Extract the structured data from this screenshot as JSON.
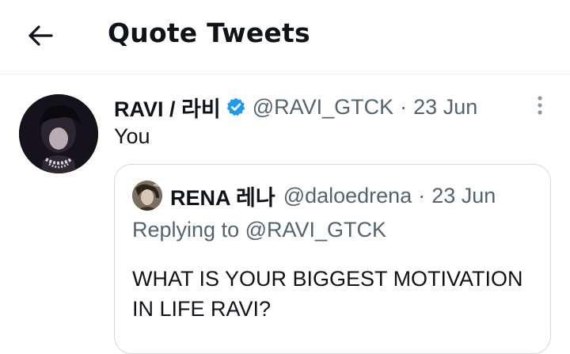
{
  "header": {
    "title": "Quote Tweets",
    "back_icon": "arrow-left-icon"
  },
  "tweet": {
    "display_name": "RAVI / 라비",
    "verified": true,
    "handle": "@RAVI_GTCK",
    "separator": "·",
    "date": "23 Jun",
    "text": "You",
    "more_icon": "more-vertical-icon",
    "quoted": {
      "display_name": "RENA 레나",
      "handle": "@daloedrena",
      "separator": "·",
      "date": "23 Jun",
      "replying_label": "Replying to",
      "replying_handle": "@RAVI_GTCK",
      "text": "WHAT IS YOUR BIGGEST MOTIVATION IN LIFE RAVI?"
    }
  },
  "colors": {
    "text": "#0f1419",
    "muted": "#536471",
    "accent": "#1d9bf0",
    "border": "#cfd9de"
  }
}
